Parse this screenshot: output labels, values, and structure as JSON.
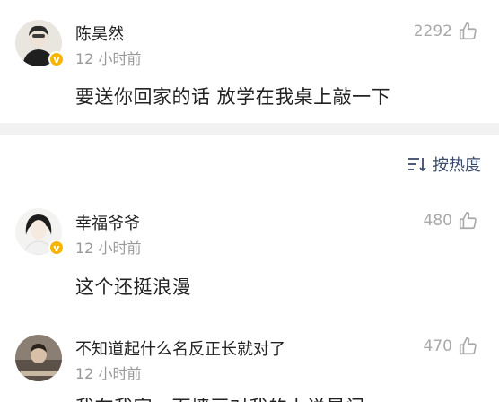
{
  "comments": [
    {
      "name": "陈昊然",
      "time": "12 小时前",
      "content": "要送你回家的话 放学在我桌上敲一下",
      "likes": "2292"
    },
    {
      "name": "幸福爷爷",
      "time": "12 小时前",
      "content": "这个还挺浪漫",
      "likes": "480"
    },
    {
      "name": "不知道起什么名反正长就对了",
      "time": "12 小时前",
      "content": "我在我家一面墙画对我的上说是门",
      "likes": "470"
    }
  ],
  "sort": {
    "label": "按热度",
    "icon": "sort-icon"
  },
  "verified_badge": "v",
  "colors": {
    "badge": "#f7b500",
    "muted": "#999999",
    "link": "#3a4a6b",
    "separator": "#f2f2f2"
  }
}
